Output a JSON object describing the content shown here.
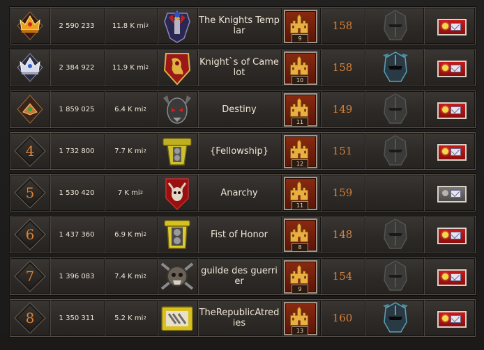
{
  "rows": [
    {
      "rank": "1",
      "points": "2 590 233",
      "area": "11.8 K mi",
      "area_unit": "2",
      "name": "The Knights Templar",
      "level": "9",
      "members": "158",
      "helm": "gray",
      "msg": "red",
      "crown": "gold"
    },
    {
      "rank": "2",
      "points": "2 384 922",
      "area": "11.9 K mi",
      "area_unit": "2",
      "name": "Knight`s of Camelot",
      "level": "10",
      "members": "158",
      "helm": "blue",
      "msg": "red",
      "crown": "silver"
    },
    {
      "rank": "3",
      "points": "1 859 025",
      "area": "6.4 K mi",
      "area_unit": "2",
      "name": "Destiny",
      "level": "11",
      "members": "149",
      "helm": "gray",
      "msg": "red",
      "crown": "bronze"
    },
    {
      "rank": "4",
      "points": "1 732 800",
      "area": "7.7 K mi",
      "area_unit": "2",
      "name": "{Fellowship}",
      "level": "12",
      "members": "151",
      "helm": "gray",
      "msg": "red",
      "crown": ""
    },
    {
      "rank": "5",
      "points": "1 530 420",
      "area": "7 K mi",
      "area_unit": "2",
      "name": "Anarchy",
      "level": "11",
      "members": "159",
      "helm": "none",
      "msg": "gray",
      "crown": ""
    },
    {
      "rank": "6",
      "points": "1 437 360",
      "area": "6.9 K mi",
      "area_unit": "2",
      "name": "Fist of Honor",
      "level": "8",
      "members": "148",
      "helm": "gray",
      "msg": "red",
      "crown": ""
    },
    {
      "rank": "7",
      "points": "1 396 083",
      "area": "7.4 K mi",
      "area_unit": "2",
      "name": "guilde des guerrier",
      "level": "9",
      "members": "154",
      "helm": "gray",
      "msg": "red",
      "crown": ""
    },
    {
      "rank": "8",
      "points": "1 350 311",
      "area": "5.2 K mi",
      "area_unit": "2",
      "name": "TheRepublicAtredies",
      "level": "13",
      "members": "160",
      "helm": "blue",
      "msg": "red",
      "crown": ""
    }
  ],
  "icons": {
    "crown_gold": "crown-gold-icon",
    "crown_silver": "crown-silver-icon",
    "crown_bronze": "crown-bronze-icon",
    "castle": "castle-icon",
    "helmet": "knight-helmet-icon",
    "message": "send-message-icon"
  },
  "colors": {
    "rank_number": "#d9823a",
    "members_number": "#d9823a",
    "message_button": "#c81a1a"
  }
}
